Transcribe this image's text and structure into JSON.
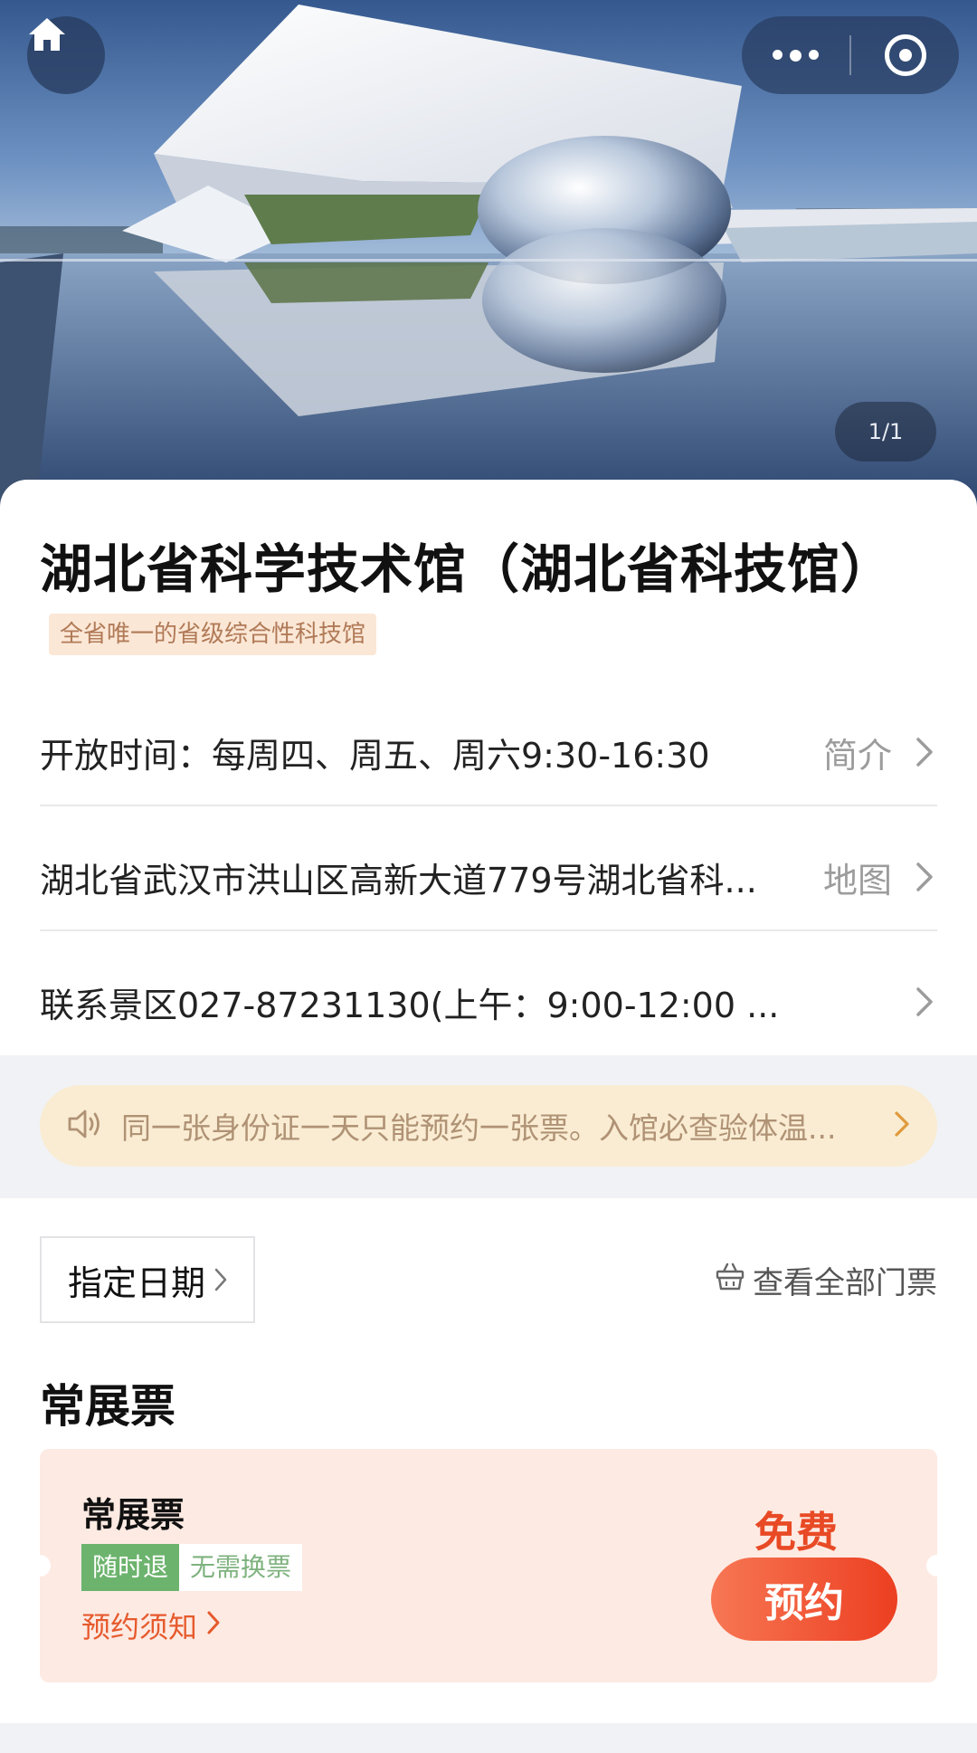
{
  "hero": {
    "counter": "1/1"
  },
  "venue": {
    "title": "湖北省科学技术馆（湖北省科技馆）",
    "tag": "全省唯一的省级综合性科技馆"
  },
  "info_rows": {
    "hours_text": "开放时间：每周四、周五、周六9:30-16:30",
    "hours_action": "简介",
    "address_text": "湖北省武汉市洪山区高新大道779号湖北省科...",
    "address_action": "地图",
    "contact_text": "联系景区027-87231130(上午：9:00-12:00 ..."
  },
  "notice": {
    "text": "同一张身份证一天只能预约一张票。入馆必查验体温..."
  },
  "tickets": {
    "date_button": "指定日期",
    "view_all": "查看全部门票",
    "section_title": "常展票",
    "card": {
      "name": "常展票",
      "badge_refund": "随时退",
      "badge_exchange": "无需换票",
      "notes_link": "预约须知",
      "price": "免费",
      "book_button": "预约"
    }
  },
  "colors": {
    "accent": "#ec3f21",
    "tag_bg": "#fbe7d6",
    "notice_bg": "#f9ecd2",
    "ticket_bg": "#fdeae3",
    "badge_green": "#6cb36d"
  },
  "icons": {
    "home": "home-icon",
    "more": "more-dots-icon",
    "close_miniprogram": "target-circle-icon",
    "speaker": "speaker-icon",
    "chevron": "chevron-right-icon",
    "ticket_basket": "basket-icon"
  }
}
